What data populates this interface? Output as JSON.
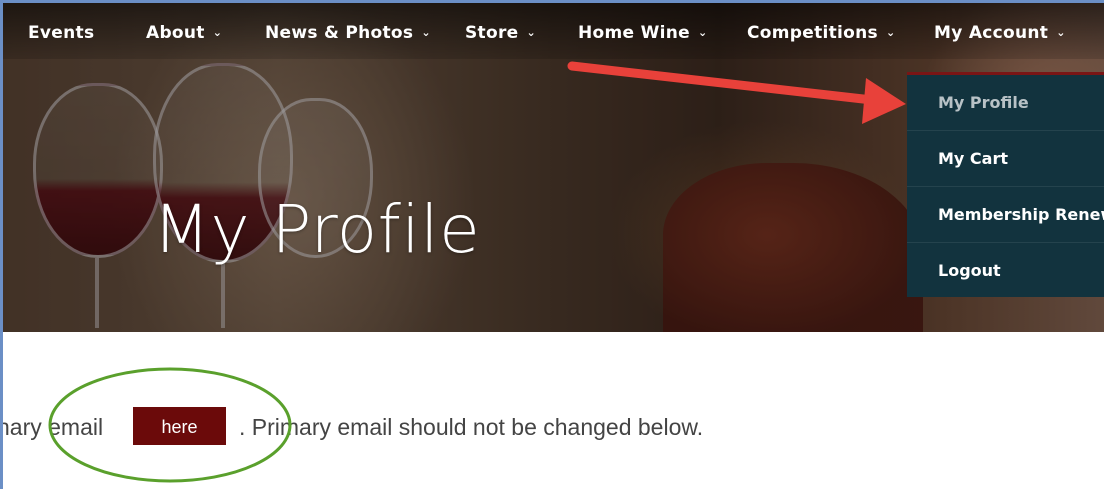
{
  "nav": {
    "items": [
      {
        "label": "Events",
        "has_chevron": false
      },
      {
        "label": "About",
        "has_chevron": true
      },
      {
        "label": "News & Photos",
        "has_chevron": true
      },
      {
        "label": "Store",
        "has_chevron": true
      },
      {
        "label": "Home Wine",
        "has_chevron": true
      },
      {
        "label": "Competitions",
        "has_chevron": true
      },
      {
        "label": "My Account",
        "has_chevron": true
      }
    ],
    "chevron_glyph": "⌄"
  },
  "dropdown": {
    "items": [
      {
        "label": "My Profile",
        "active": true
      },
      {
        "label": "My Cart",
        "active": false
      },
      {
        "label": "Membership Renewal",
        "active": false
      },
      {
        "label": "Logout",
        "active": false
      }
    ]
  },
  "hero": {
    "title": "My Profile"
  },
  "email_notice": {
    "prefix": "nary email",
    "button_label": "here",
    "suffix": ". Primary email should not be changed below."
  },
  "colors": {
    "dropdown_bg": "#12333e",
    "dropdown_accent": "#7a1515",
    "button_bg": "#6b0a0a",
    "annotation_arrow": "#e8413a",
    "annotation_circle": "#5aa02c"
  },
  "icons": {
    "chevron": "chevron-down-icon",
    "annotation_arrow": "arrow-annotation",
    "annotation_circle": "circle-annotation"
  }
}
